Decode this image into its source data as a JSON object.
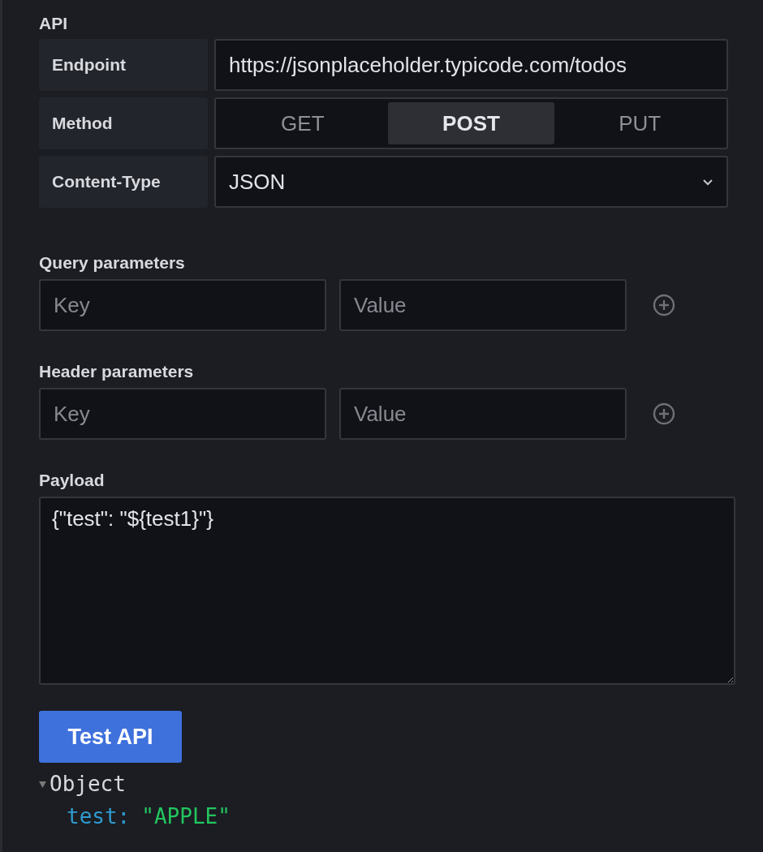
{
  "section_title": "API",
  "settings": [
    {
      "kind": "text",
      "label": "Endpoint",
      "value": "https://jsonplaceholder.typicode.com/todos"
    },
    {
      "kind": "segmented",
      "label": "Method",
      "options": [
        {
          "label": "GET",
          "selected": false
        },
        {
          "label": "POST",
          "selected": true
        },
        {
          "label": "PUT",
          "selected": false
        }
      ]
    },
    {
      "kind": "select",
      "label": "Content-Type",
      "value": "JSON"
    }
  ],
  "param_groups": [
    {
      "title": "Query parameters",
      "key_placeholder": "Key",
      "value_placeholder": "Value"
    },
    {
      "title": "Header parameters",
      "key_placeholder": "Key",
      "value_placeholder": "Value"
    }
  ],
  "payload": {
    "label": "Payload",
    "value": "{\"test\": \"${test1}\"}"
  },
  "test_button": "Test API",
  "result": {
    "label": "Object",
    "expanded": true,
    "entries": [
      {
        "key": "test:",
        "value": "\"APPLE\""
      }
    ]
  }
}
